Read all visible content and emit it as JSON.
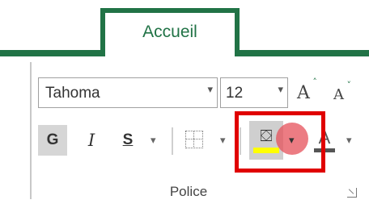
{
  "ribbon": {
    "active_tab": "Accueil",
    "group_label": "Police"
  },
  "font": {
    "name": "Tahoma",
    "size": "12",
    "dropdown_caret": "▾"
  },
  "buttons": {
    "bold": "G",
    "italic": "I",
    "underline": "S",
    "grow_font": "A",
    "shrink_font": "A",
    "font_color": "A",
    "caret": "▾",
    "arrow_up": "˄",
    "bucket_glyph": "⛋"
  },
  "colors": {
    "accent": "#217346",
    "fill_color": "#ffff00",
    "highlight": "#e00000"
  },
  "icons": [
    "bucket-icon",
    "borders-icon",
    "dialog-launcher-icon"
  ]
}
